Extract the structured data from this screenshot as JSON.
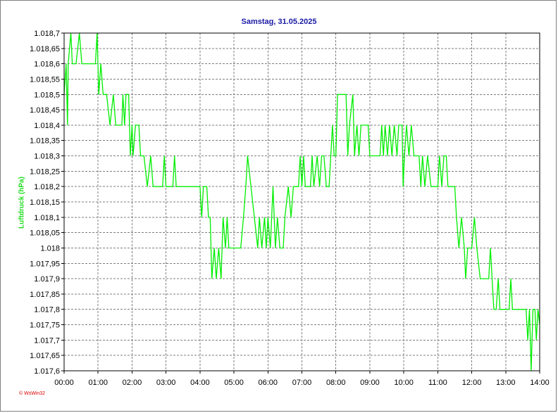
{
  "chart_data": {
    "type": "line",
    "title": "Samstag, 31.05.2025",
    "xlabel": "",
    "ylabel": "Luftdruck  (hPa)",
    "x_range_hours": [
      0,
      14
    ],
    "xlim": [
      "00:00",
      "14:00"
    ],
    "ylim": [
      1017.6,
      1018.7
    ],
    "x_tick_labels": [
      "00:00",
      "01:00",
      "02:00",
      "03:00",
      "04:00",
      "05:00",
      "06:00",
      "07:00",
      "08:00",
      "09:00",
      "10:00",
      "11:00",
      "12:00",
      "13:00",
      "14:00"
    ],
    "y_tick_labels": [
      "1.018,7",
      "1.018,65",
      "1.018,6",
      "1.018,55",
      "1.018,5",
      "1.018,45",
      "1.018,4",
      "1.018,35",
      "1.018,3",
      "1.018,25",
      "1.018,2",
      "1.018,15",
      "1.018,1",
      "1.018,05",
      "1.018",
      "1.017,95",
      "1.017,9",
      "1.017,85",
      "1.017,8",
      "1.017,75",
      "1.017,7",
      "1.017,65",
      "1.017,6"
    ],
    "grid": true,
    "legend": "none",
    "series": [
      {
        "color": "#00ee00",
        "points": [
          [
            0.0,
            1018.5
          ],
          [
            0.06,
            1018.6
          ],
          [
            0.1,
            1018.4
          ],
          [
            0.12,
            1018.6
          ],
          [
            0.2,
            1018.7
          ],
          [
            0.24,
            1018.6
          ],
          [
            0.35,
            1018.6
          ],
          [
            0.45,
            1018.7
          ],
          [
            0.52,
            1018.6
          ],
          [
            0.92,
            1018.6
          ],
          [
            0.97,
            1018.7
          ],
          [
            1.02,
            1018.5
          ],
          [
            1.08,
            1018.6
          ],
          [
            1.15,
            1018.5
          ],
          [
            1.25,
            1018.5
          ],
          [
            1.3,
            1018.45
          ],
          [
            1.35,
            1018.4
          ],
          [
            1.45,
            1018.5
          ],
          [
            1.52,
            1018.4
          ],
          [
            1.7,
            1018.4
          ],
          [
            1.73,
            1018.5
          ],
          [
            1.78,
            1018.4
          ],
          [
            1.82,
            1018.5
          ],
          [
            1.9,
            1018.5
          ],
          [
            1.95,
            1018.3
          ],
          [
            2.0,
            1018.4
          ],
          [
            2.03,
            1018.3
          ],
          [
            2.1,
            1018.4
          ],
          [
            2.2,
            1018.4
          ],
          [
            2.25,
            1018.3
          ],
          [
            2.35,
            1018.3
          ],
          [
            2.45,
            1018.2
          ],
          [
            2.55,
            1018.3
          ],
          [
            2.62,
            1018.2
          ],
          [
            2.9,
            1018.2
          ],
          [
            2.95,
            1018.3
          ],
          [
            3.0,
            1018.2
          ],
          [
            3.2,
            1018.2
          ],
          [
            3.25,
            1018.3
          ],
          [
            3.3,
            1018.2
          ],
          [
            4.0,
            1018.2
          ],
          [
            4.05,
            1018.1
          ],
          [
            4.1,
            1018.2
          ],
          [
            4.2,
            1018.2
          ],
          [
            4.25,
            1018.1
          ],
          [
            4.3,
            1018.1
          ],
          [
            4.35,
            1017.9
          ],
          [
            4.42,
            1018.0
          ],
          [
            4.48,
            1017.9
          ],
          [
            4.55,
            1018.0
          ],
          [
            4.62,
            1017.9
          ],
          [
            4.68,
            1018.1
          ],
          [
            4.75,
            1018.0
          ],
          [
            4.8,
            1018.1
          ],
          [
            4.85,
            1018.0
          ],
          [
            5.2,
            1018.0
          ],
          [
            5.28,
            1018.1
          ],
          [
            5.35,
            1018.2
          ],
          [
            5.4,
            1018.3
          ],
          [
            5.5,
            1018.2
          ],
          [
            5.6,
            1018.1
          ],
          [
            5.7,
            1018.0
          ],
          [
            5.75,
            1018.1
          ],
          [
            5.82,
            1018.0
          ],
          [
            5.9,
            1018.1
          ],
          [
            5.95,
            1018.0
          ],
          [
            6.0,
            1018.1
          ],
          [
            6.07,
            1018.0
          ],
          [
            6.15,
            1018.2
          ],
          [
            6.22,
            1018.0
          ],
          [
            6.28,
            1018.1
          ],
          [
            6.35,
            1018.0
          ],
          [
            6.45,
            1018.0
          ],
          [
            6.5,
            1018.1
          ],
          [
            6.6,
            1018.2
          ],
          [
            6.68,
            1018.1
          ],
          [
            6.75,
            1018.2
          ],
          [
            6.9,
            1018.2
          ],
          [
            6.95,
            1018.3
          ],
          [
            7.0,
            1018.2
          ],
          [
            7.05,
            1018.3
          ],
          [
            7.1,
            1018.2
          ],
          [
            7.25,
            1018.2
          ],
          [
            7.3,
            1018.3
          ],
          [
            7.35,
            1018.2
          ],
          [
            7.45,
            1018.3
          ],
          [
            7.52,
            1018.2
          ],
          [
            7.58,
            1018.3
          ],
          [
            7.65,
            1018.3
          ],
          [
            7.72,
            1018.2
          ],
          [
            7.8,
            1018.2
          ],
          [
            7.85,
            1018.3
          ],
          [
            7.9,
            1018.4
          ],
          [
            7.95,
            1018.3
          ],
          [
            8.0,
            1018.3
          ],
          [
            8.05,
            1018.5
          ],
          [
            8.3,
            1018.5
          ],
          [
            8.35,
            1018.3
          ],
          [
            8.4,
            1018.4
          ],
          [
            8.5,
            1018.5
          ],
          [
            8.55,
            1018.3
          ],
          [
            8.62,
            1018.4
          ],
          [
            8.68,
            1018.3
          ],
          [
            8.74,
            1018.4
          ],
          [
            8.8,
            1018.4
          ],
          [
            8.95,
            1018.4
          ],
          [
            9.0,
            1018.3
          ],
          [
            9.3,
            1018.3
          ],
          [
            9.35,
            1018.4
          ],
          [
            9.4,
            1018.3
          ],
          [
            9.45,
            1018.4
          ],
          [
            9.52,
            1018.3
          ],
          [
            9.58,
            1018.4
          ],
          [
            9.65,
            1018.3
          ],
          [
            9.72,
            1018.4
          ],
          [
            9.8,
            1018.3
          ],
          [
            9.85,
            1018.4
          ],
          [
            9.95,
            1018.4
          ],
          [
            9.98,
            1018.2
          ],
          [
            10.02,
            1018.3
          ],
          [
            10.08,
            1018.4
          ],
          [
            10.15,
            1018.3
          ],
          [
            10.22,
            1018.4
          ],
          [
            10.3,
            1018.3
          ],
          [
            10.45,
            1018.3
          ],
          [
            10.5,
            1018.2
          ],
          [
            10.55,
            1018.3
          ],
          [
            10.62,
            1018.2
          ],
          [
            10.7,
            1018.3
          ],
          [
            10.8,
            1018.2
          ],
          [
            11.0,
            1018.2
          ],
          [
            11.05,
            1018.3
          ],
          [
            11.12,
            1018.2
          ],
          [
            11.18,
            1018.3
          ],
          [
            11.25,
            1018.3
          ],
          [
            11.3,
            1018.2
          ],
          [
            11.5,
            1018.2
          ],
          [
            11.55,
            1018.1
          ],
          [
            11.62,
            1018.0
          ],
          [
            11.7,
            1018.1
          ],
          [
            11.78,
            1018.0
          ],
          [
            11.82,
            1017.9
          ],
          [
            11.88,
            1018.0
          ],
          [
            12.0,
            1018.0
          ],
          [
            12.08,
            1018.1
          ],
          [
            12.15,
            1018.0
          ],
          [
            12.25,
            1017.9
          ],
          [
            12.5,
            1017.9
          ],
          [
            12.55,
            1018.0
          ],
          [
            12.6,
            1017.9
          ],
          [
            12.65,
            1017.8
          ],
          [
            12.72,
            1017.8
          ],
          [
            12.78,
            1017.9
          ],
          [
            12.83,
            1017.8
          ],
          [
            13.1,
            1017.8
          ],
          [
            13.15,
            1017.9
          ],
          [
            13.2,
            1017.8
          ],
          [
            13.6,
            1017.8
          ],
          [
            13.65,
            1017.7
          ],
          [
            13.7,
            1017.8
          ],
          [
            13.75,
            1017.6
          ],
          [
            13.8,
            1017.8
          ],
          [
            13.86,
            1017.8
          ],
          [
            13.9,
            1017.7
          ],
          [
            13.95,
            1017.8
          ],
          [
            14.0,
            1017.75
          ]
        ]
      }
    ]
  },
  "credit": "© WsWin32"
}
